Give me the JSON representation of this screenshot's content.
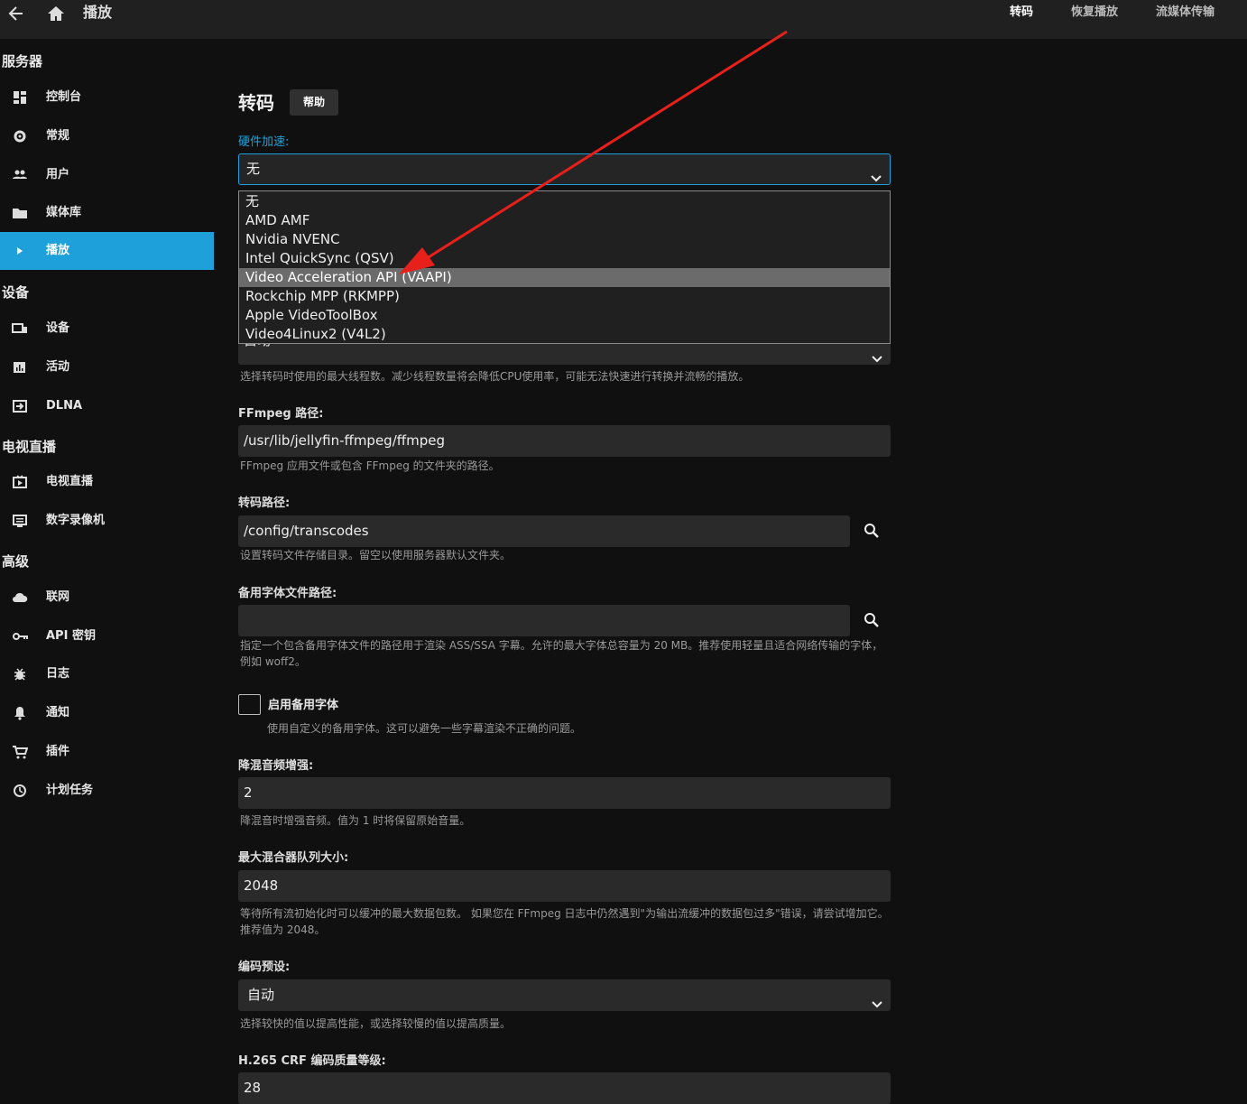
{
  "topbar": {
    "title": "播放",
    "tabs": [
      "转码",
      "恢复播放",
      "流媒体传输"
    ]
  },
  "sidebar": {
    "sections": [
      "服务器",
      "设备",
      "电视直播",
      "高级"
    ],
    "items": [
      {
        "label": "控制台",
        "icon": "dashboard-icon"
      },
      {
        "label": "常规",
        "icon": "gear-icon"
      },
      {
        "label": "用户",
        "icon": "users-icon"
      },
      {
        "label": "媒体库",
        "icon": "folder-icon"
      },
      {
        "label": "播放",
        "icon": "play-icon"
      },
      {
        "label": "设备",
        "icon": "devices-icon"
      },
      {
        "label": "活动",
        "icon": "chart-icon"
      },
      {
        "label": "DLNA",
        "icon": "input-icon"
      },
      {
        "label": "电视直播",
        "icon": "live-tv-icon"
      },
      {
        "label": "数字录像机",
        "icon": "dvr-icon"
      },
      {
        "label": "联网",
        "icon": "cloud-icon"
      },
      {
        "label": "API 密钥",
        "icon": "key-icon"
      },
      {
        "label": "日志",
        "icon": "bug-icon"
      },
      {
        "label": "通知",
        "icon": "bell-icon"
      },
      {
        "label": "插件",
        "icon": "cart-icon"
      },
      {
        "label": "计划任务",
        "icon": "clock-icon"
      }
    ]
  },
  "main": {
    "heading": "转码",
    "help_label": "帮助",
    "hw": {
      "label": "硬件加速:",
      "value": "无",
      "options": [
        "无",
        "AMD AMF",
        "Nvidia NVENC",
        "Intel QuickSync (QSV)",
        "Video Acceleration API (VAAPI)",
        "Rockchip MPP (RKMPP)",
        "Apple VideoToolBox",
        "Video4Linux2 (V4L2)"
      ],
      "highlighted": "Video Acceleration API (VAAPI)"
    },
    "threads": {
      "value": "自动",
      "hint": "选择转码时使用的最大线程数。减少线程数量将会降低CPU使用率，可能无法快速进行转换并流畅的播放。"
    },
    "ffmpeg": {
      "label": "FFmpeg 路径:",
      "value": "/usr/lib/jellyfin-ffmpeg/ffmpeg",
      "hint": "FFmpeg 应用文件或包含 FFmpeg 的文件夹的路径。"
    },
    "transcode_path": {
      "label": "转码路径:",
      "value": "/config/transcodes",
      "hint": "设置转码文件存储目录。留空以使用服务器默认文件夹。"
    },
    "fallback_font_path": {
      "label": "备用字体文件路径:",
      "value": "",
      "hint": "指定一个包含备用字体文件的路径用于渲染 ASS/SSA 字幕。允许的最大字体总容量为 20 MB。推荐使用轻量且适合网络传输的字体，例如 woff2。"
    },
    "enable_fallback_font": {
      "label": "启用备用字体",
      "hint": "使用自定义的备用字体。这可以避免一些字幕渲染不正确的问题。"
    },
    "downmix": {
      "label": "降混音频增强:",
      "value": "2",
      "hint": "降混音时增强音频。值为 1 时将保留原始音量。"
    },
    "muxing_queue": {
      "label": "最大混合器队列大小:",
      "value": "2048",
      "hint": "等待所有流初始化时可以缓冲的最大数据包数。 如果您在 FFmpeg 日志中仍然遇到\"为输出流缓冲的数据包过多\"错误，请尝试增加它。 推荐值为 2048。"
    },
    "encoder_preset": {
      "label": "编码预设:",
      "value": "自动",
      "hint": "选择较快的值以提高性能，或选择较慢的值以提高质量。"
    },
    "h265_crf": {
      "label": "H.265 CRF 编码质量等级:",
      "value": "28"
    }
  },
  "colors": {
    "accent": "#1ea1db",
    "arrow": "#e8201b",
    "background": "#101010",
    "topbar": "#202020",
    "field": "#2a2a2a"
  }
}
